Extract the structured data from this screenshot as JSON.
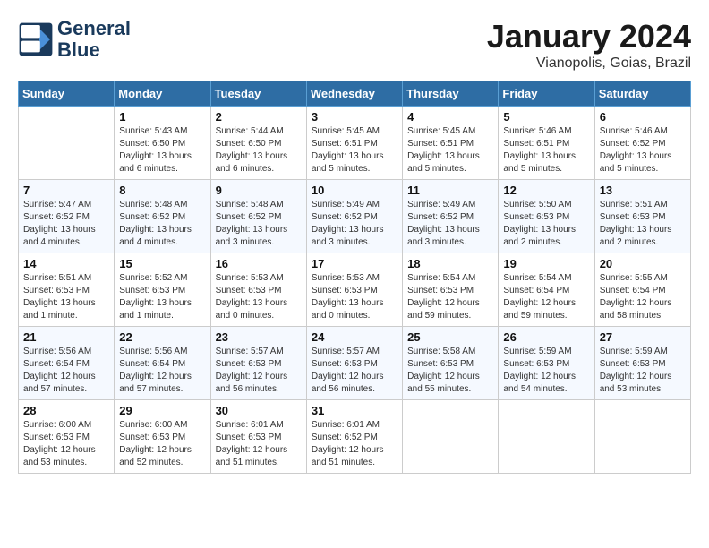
{
  "header": {
    "logo_line1": "General",
    "logo_line2": "Blue",
    "month": "January 2024",
    "location": "Vianopolis, Goias, Brazil"
  },
  "weekdays": [
    "Sunday",
    "Monday",
    "Tuesday",
    "Wednesday",
    "Thursday",
    "Friday",
    "Saturday"
  ],
  "weeks": [
    [
      {
        "day": "",
        "text": ""
      },
      {
        "day": "1",
        "text": "Sunrise: 5:43 AM\nSunset: 6:50 PM\nDaylight: 13 hours\nand 6 minutes."
      },
      {
        "day": "2",
        "text": "Sunrise: 5:44 AM\nSunset: 6:50 PM\nDaylight: 13 hours\nand 6 minutes."
      },
      {
        "day": "3",
        "text": "Sunrise: 5:45 AM\nSunset: 6:51 PM\nDaylight: 13 hours\nand 5 minutes."
      },
      {
        "day": "4",
        "text": "Sunrise: 5:45 AM\nSunset: 6:51 PM\nDaylight: 13 hours\nand 5 minutes."
      },
      {
        "day": "5",
        "text": "Sunrise: 5:46 AM\nSunset: 6:51 PM\nDaylight: 13 hours\nand 5 minutes."
      },
      {
        "day": "6",
        "text": "Sunrise: 5:46 AM\nSunset: 6:52 PM\nDaylight: 13 hours\nand 5 minutes."
      }
    ],
    [
      {
        "day": "7",
        "text": "Sunrise: 5:47 AM\nSunset: 6:52 PM\nDaylight: 13 hours\nand 4 minutes."
      },
      {
        "day": "8",
        "text": "Sunrise: 5:48 AM\nSunset: 6:52 PM\nDaylight: 13 hours\nand 4 minutes."
      },
      {
        "day": "9",
        "text": "Sunrise: 5:48 AM\nSunset: 6:52 PM\nDaylight: 13 hours\nand 3 minutes."
      },
      {
        "day": "10",
        "text": "Sunrise: 5:49 AM\nSunset: 6:52 PM\nDaylight: 13 hours\nand 3 minutes."
      },
      {
        "day": "11",
        "text": "Sunrise: 5:49 AM\nSunset: 6:52 PM\nDaylight: 13 hours\nand 3 minutes."
      },
      {
        "day": "12",
        "text": "Sunrise: 5:50 AM\nSunset: 6:53 PM\nDaylight: 13 hours\nand 2 minutes."
      },
      {
        "day": "13",
        "text": "Sunrise: 5:51 AM\nSunset: 6:53 PM\nDaylight: 13 hours\nand 2 minutes."
      }
    ],
    [
      {
        "day": "14",
        "text": "Sunrise: 5:51 AM\nSunset: 6:53 PM\nDaylight: 13 hours\nand 1 minute."
      },
      {
        "day": "15",
        "text": "Sunrise: 5:52 AM\nSunset: 6:53 PM\nDaylight: 13 hours\nand 1 minute."
      },
      {
        "day": "16",
        "text": "Sunrise: 5:53 AM\nSunset: 6:53 PM\nDaylight: 13 hours\nand 0 minutes."
      },
      {
        "day": "17",
        "text": "Sunrise: 5:53 AM\nSunset: 6:53 PM\nDaylight: 13 hours\nand 0 minutes."
      },
      {
        "day": "18",
        "text": "Sunrise: 5:54 AM\nSunset: 6:53 PM\nDaylight: 12 hours\nand 59 minutes."
      },
      {
        "day": "19",
        "text": "Sunrise: 5:54 AM\nSunset: 6:54 PM\nDaylight: 12 hours\nand 59 minutes."
      },
      {
        "day": "20",
        "text": "Sunrise: 5:55 AM\nSunset: 6:54 PM\nDaylight: 12 hours\nand 58 minutes."
      }
    ],
    [
      {
        "day": "21",
        "text": "Sunrise: 5:56 AM\nSunset: 6:54 PM\nDaylight: 12 hours\nand 57 minutes."
      },
      {
        "day": "22",
        "text": "Sunrise: 5:56 AM\nSunset: 6:54 PM\nDaylight: 12 hours\nand 57 minutes."
      },
      {
        "day": "23",
        "text": "Sunrise: 5:57 AM\nSunset: 6:53 PM\nDaylight: 12 hours\nand 56 minutes."
      },
      {
        "day": "24",
        "text": "Sunrise: 5:57 AM\nSunset: 6:53 PM\nDaylight: 12 hours\nand 56 minutes."
      },
      {
        "day": "25",
        "text": "Sunrise: 5:58 AM\nSunset: 6:53 PM\nDaylight: 12 hours\nand 55 minutes."
      },
      {
        "day": "26",
        "text": "Sunrise: 5:59 AM\nSunset: 6:53 PM\nDaylight: 12 hours\nand 54 minutes."
      },
      {
        "day": "27",
        "text": "Sunrise: 5:59 AM\nSunset: 6:53 PM\nDaylight: 12 hours\nand 53 minutes."
      }
    ],
    [
      {
        "day": "28",
        "text": "Sunrise: 6:00 AM\nSunset: 6:53 PM\nDaylight: 12 hours\nand 53 minutes."
      },
      {
        "day": "29",
        "text": "Sunrise: 6:00 AM\nSunset: 6:53 PM\nDaylight: 12 hours\nand 52 minutes."
      },
      {
        "day": "30",
        "text": "Sunrise: 6:01 AM\nSunset: 6:53 PM\nDaylight: 12 hours\nand 51 minutes."
      },
      {
        "day": "31",
        "text": "Sunrise: 6:01 AM\nSunset: 6:52 PM\nDaylight: 12 hours\nand 51 minutes."
      },
      {
        "day": "",
        "text": ""
      },
      {
        "day": "",
        "text": ""
      },
      {
        "day": "",
        "text": ""
      }
    ]
  ]
}
